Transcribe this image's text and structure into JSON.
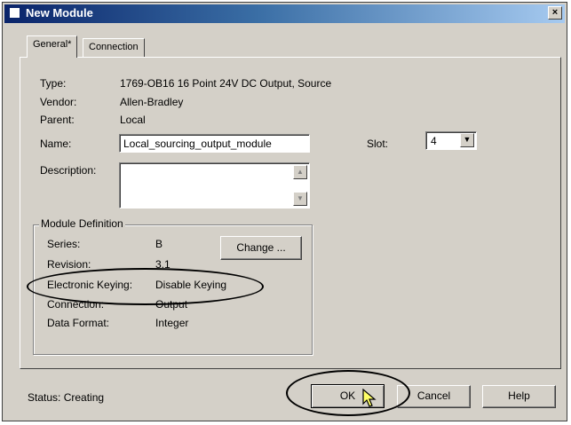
{
  "window": {
    "title": "New Module",
    "close_glyph": "×"
  },
  "tabs": [
    {
      "label": "General*",
      "active": true
    },
    {
      "label": "Connection",
      "active": false
    }
  ],
  "general": {
    "type_label": "Type:",
    "type_value": "1769-OB16 16 Point 24V DC Output, Source",
    "vendor_label": "Vendor:",
    "vendor_value": "Allen-Bradley",
    "parent_label": "Parent:",
    "parent_value": "Local",
    "name_label": "Name:",
    "name_value": "Local_sourcing_output_module",
    "slot_label": "Slot:",
    "slot_value": "4",
    "description_label": "Description:",
    "description_value": ""
  },
  "module_definition": {
    "legend": "Module Definition",
    "series_label": "Series:",
    "series_value": "B",
    "revision_label": "Revision:",
    "revision_value": "3.1",
    "keying_label": "Electronic Keying:",
    "keying_value": "Disable Keying",
    "connection_label": "Connection:",
    "connection_value": "Output",
    "data_format_label": "Data Format:",
    "data_format_value": "Integer",
    "change_button": "Change ..."
  },
  "footer": {
    "status_text": "Status:  Creating",
    "ok_button": "OK",
    "cancel_button": "Cancel",
    "help_button": "Help"
  },
  "icons": {
    "close": "close-icon",
    "dropdown": "chevron-down-icon",
    "scroll_up": "scroll-up-icon",
    "scroll_down": "scroll-down-icon",
    "cursor": "mouse-pointer-icon"
  },
  "colors": {
    "title_start": "#0a246a",
    "title_end": "#a6caf0",
    "face": "#d4d0c8"
  }
}
